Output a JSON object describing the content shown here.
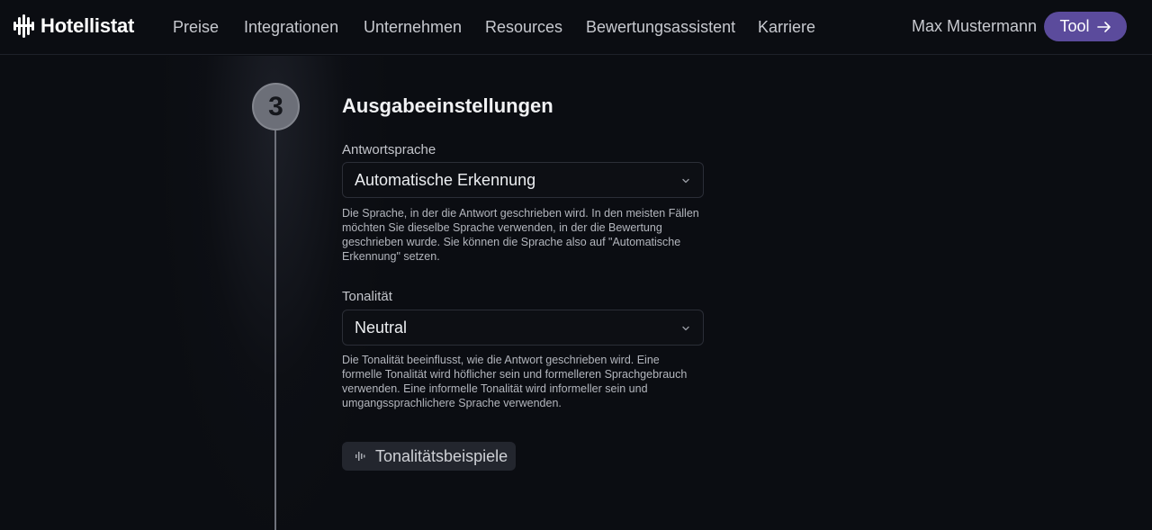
{
  "header": {
    "brand": "Hotellistat",
    "nav": [
      "Preise",
      "Integrationen",
      "Unternehmen",
      "Resources",
      "Bewertungsassistent",
      "Karriere"
    ],
    "user_name": "Max Mustermann",
    "tool_label": "Tool"
  },
  "step": {
    "number": "3",
    "title": "Ausgabeeinstellungen"
  },
  "fields": {
    "language": {
      "label": "Antwortsprache",
      "value": "Automatische Erkennung",
      "help": "Die Sprache, in der die Antwort geschrieben wird. In den meisten Fällen möchten Sie dieselbe Sprache verwenden, in der die Bewertung geschrieben wurde. Sie können die Sprache also auf \"Automatische Erkennung\" setzen."
    },
    "tonality": {
      "label": "Tonalität",
      "value": "Neutral",
      "help": "Die Tonalität beeinflusst, wie die Antwort geschrieben wird. Eine formelle Tonalität wird höflicher sein und formelleren Sprachgebrauch verwenden. Eine informelle Tonalität wird informeller sein und umgangssprachlichere Sprache verwenden."
    }
  },
  "examples_button": "Tonalitätsbeispiele",
  "icons": {
    "logo": "hotellistat-logo-icon",
    "tool_arrow": "arrow-right-icon",
    "dropdown": "chevron-down-icon",
    "examples": "audio-wave-icon"
  },
  "colors": {
    "background": "#0b0d12",
    "accent": "#5b4b9c",
    "step_circle": "#6c6f78"
  }
}
